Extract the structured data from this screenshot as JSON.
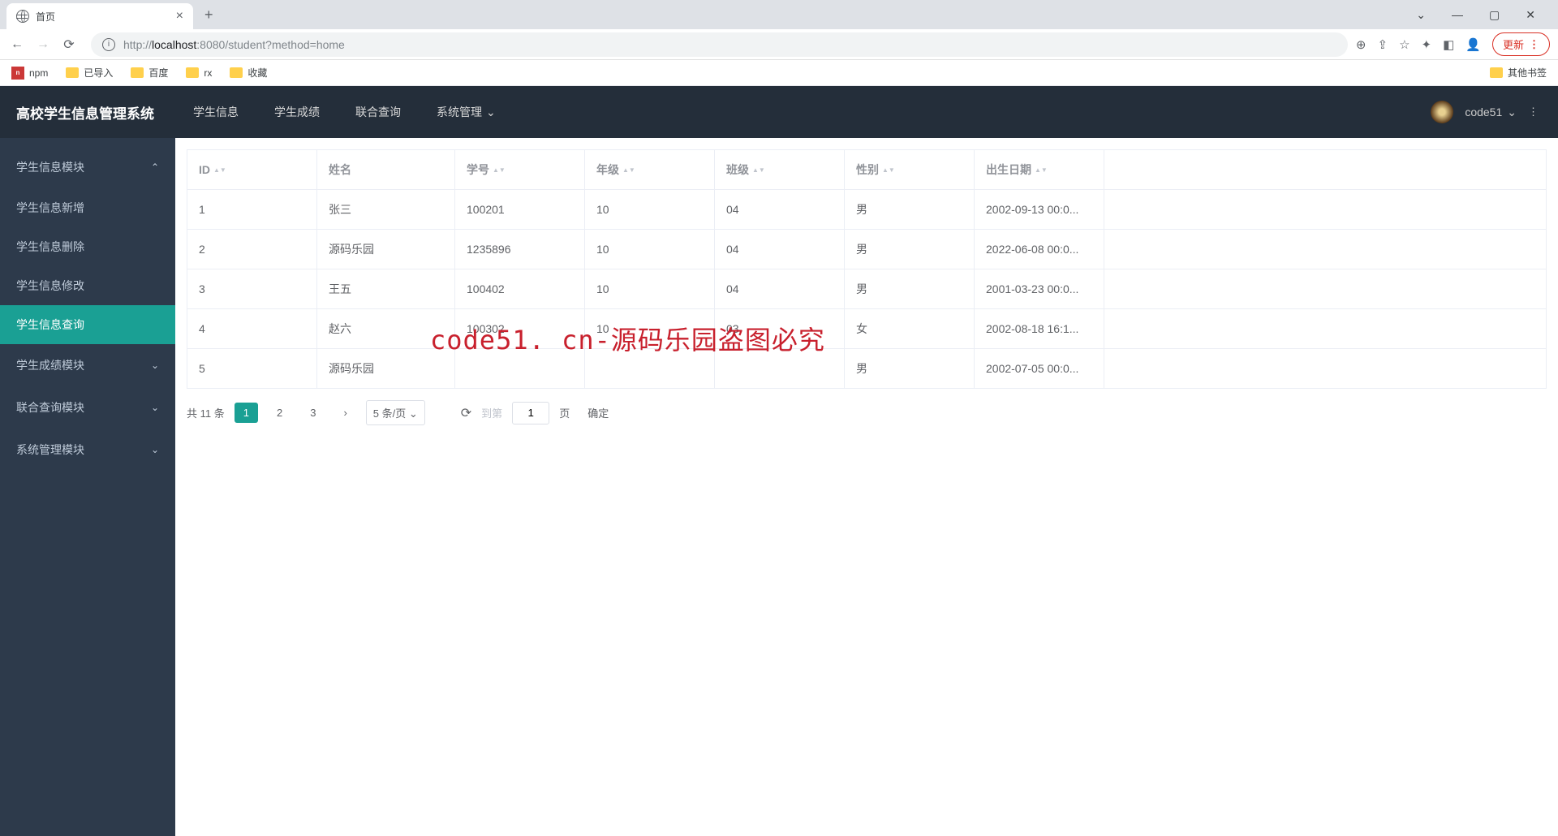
{
  "browser": {
    "tab_title": "首页",
    "url_prefix": "http://",
    "url_host": "localhost",
    "url_port": ":8080",
    "url_path": "/student?method=home",
    "update_label": "更新"
  },
  "bookmarks": {
    "items": [
      "npm",
      "已导入",
      "百度",
      "rx",
      "收藏"
    ],
    "other": "其他书签"
  },
  "header": {
    "brand": "高校学生信息管理系统",
    "nav": [
      "学生信息",
      "学生成绩",
      "联合查询",
      "系统管理"
    ],
    "username": "code51"
  },
  "sidebar": {
    "groups": [
      {
        "label": "学生信息模块",
        "expanded": true,
        "children": [
          "学生信息新增",
          "学生信息删除",
          "学生信息修改",
          "学生信息查询"
        ],
        "active_index": 3
      },
      {
        "label": "学生成绩模块",
        "expanded": false
      },
      {
        "label": "联合查询模块",
        "expanded": false
      },
      {
        "label": "系统管理模块",
        "expanded": false
      }
    ]
  },
  "table": {
    "headers": [
      "ID",
      "姓名",
      "学号",
      "年级",
      "班级",
      "性别",
      "出生日期"
    ],
    "rows": [
      {
        "id": "1",
        "name": "张三",
        "sno": "100201",
        "grade": "10",
        "class": "04",
        "gender": "男",
        "birth": "2002-09-13 00:0..."
      },
      {
        "id": "2",
        "name": "源码乐园",
        "sno": "1235896",
        "grade": "10",
        "class": "04",
        "gender": "男",
        "birth": "2022-06-08 00:0..."
      },
      {
        "id": "3",
        "name": "王五",
        "sno": "100402",
        "grade": "10",
        "class": "04",
        "gender": "男",
        "birth": "2001-03-23 00:0..."
      },
      {
        "id": "4",
        "name": "赵六",
        "sno": "100302",
        "grade": "10",
        "class": "03",
        "gender": "女",
        "birth": "2002-08-18 16:1..."
      },
      {
        "id": "5",
        "name": "源码乐园",
        "sno": "",
        "grade": "",
        "class": "",
        "gender": "男",
        "birth": "2002-07-05 00:0..."
      }
    ]
  },
  "pager": {
    "total": "共 11 条",
    "pages": [
      "1",
      "2",
      "3"
    ],
    "per_page": "5 条/页",
    "goto_label": "到第",
    "goto_value": "1",
    "page_suffix": "页",
    "confirm": "确定"
  },
  "watermark": "code51. cn-源码乐园盗图必究"
}
